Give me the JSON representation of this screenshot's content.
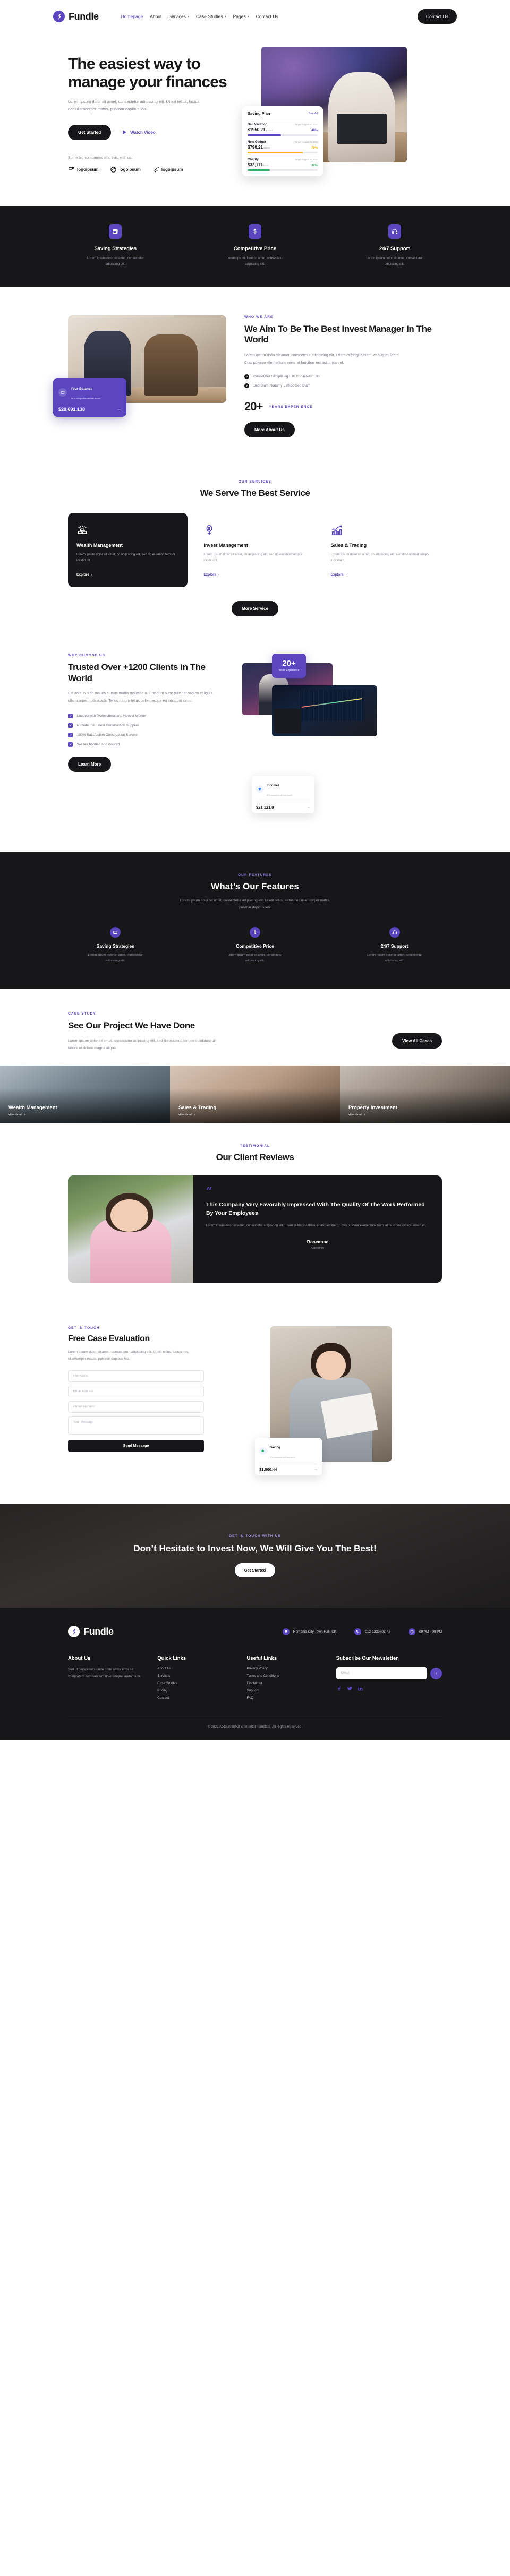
{
  "brand": {
    "name": "Fundle",
    "mark": "fundle-logo-icon"
  },
  "nav": {
    "links": [
      {
        "label": "Homepage",
        "active": true,
        "caret": false
      },
      {
        "label": "About",
        "active": false,
        "caret": false
      },
      {
        "label": "Services",
        "active": false,
        "caret": true
      },
      {
        "label": "Case Studies",
        "active": false,
        "caret": true
      },
      {
        "label": "Pages",
        "active": false,
        "caret": true
      },
      {
        "label": "Contact Us",
        "active": false,
        "caret": false
      }
    ],
    "cta": "Contact Us"
  },
  "hero": {
    "title": "The easiest way to manage your finances",
    "subtitle": "Lorem ipsum dolor sit amet, consectetur adipiscing elit. Ut elit tellus, luctus nec ullamcorper mattis, pulvinar dapibus leo.",
    "primary_cta": "Get Started",
    "video_cta": "Watch Video",
    "trust_label": "Some big companies who trust with us:",
    "logos": [
      "logoipsum",
      "logoipsum",
      "logoipsum"
    ],
    "saving_card": {
      "title": "Saving Plan",
      "see_all": "See All",
      "rows": [
        {
          "name": "Bali Vacation",
          "target": "Target: August 25 2022",
          "amount": "$1950,21",
          "of": "/$4000",
          "pct": "48%",
          "pct_color": "#5b46c0",
          "fill": 48
        },
        {
          "name": "New Gadget",
          "target": "Target: August 25 2022",
          "amount": "$790,21",
          "of": "/$1000",
          "pct": "79%",
          "pct_color": "#f2b705",
          "fill": 79
        },
        {
          "name": "Charity",
          "target": "Target: August 25 2022",
          "amount": "$32,111",
          "of": "/$100",
          "pct": "32%",
          "pct_color": "#34b36a",
          "fill": 32
        }
      ]
    }
  },
  "strip": {
    "items": [
      {
        "icon": "wallet-icon",
        "title": "Saving Strategies",
        "text": "Lorem ipsum dolor sit amet, consectetur adipiscing elit."
      },
      {
        "icon": "dollar-icon",
        "title": "Competitive Price",
        "text": "Lorem ipsum dolor sit amet, consectetur adipiscing elit."
      },
      {
        "icon": "headset-icon",
        "title": "24/7 Support",
        "text": "Lorem ipsum dolor sit amet, consectetur adipiscing elit."
      }
    ]
  },
  "about": {
    "eyebrow": "WHO WE ARE",
    "title": "We Aim To Be The Best Invest Manager In The World",
    "body": "Lorem ipsum dolor sit amet, consectetur adipiscing elit. Etiam et fringilla diam, et aliquet libero. Cras pulvinar elementum enim, at faucibus est accumsan et.",
    "ticks": [
      "Consetetur Sadipscing Elitr Consetetur Elitr",
      "Sed Diam Nonumy Eirmod Sed Diam"
    ],
    "years_number": "20+",
    "years_label": "YEARS EXPERIENCE",
    "cta": "More About Us",
    "balance_card": {
      "title": "Your Balance",
      "sub": "13 % compared with last month",
      "amount": "$28,891,138",
      "arrow": "→"
    }
  },
  "services": {
    "eyebrow": "OUR SERVICES",
    "title": "We Serve The Best Service",
    "cards": [
      {
        "icon": "gold-bars-icon",
        "title": "Wealth Management",
        "text": "Lorem ipsum dolor sit amet, co adipiscing elit, sed do eiusmod tempor incididunt.",
        "link": "Explore",
        "dark": true
      },
      {
        "icon": "money-plant-icon",
        "title": "Invest Management",
        "text": "Lorem ipsum dolor sit amet, co adipiscing elit, sed do eiusmod tempor incididunt.",
        "link": "Explore",
        "dark": false
      },
      {
        "icon": "chart-up-icon",
        "title": "Sales & Trading",
        "text": "Lorem ipsum dolor sit amet, co adipiscing elit, sed do eiusmod tempor incididunt.",
        "link": "Explore",
        "dark": false
      }
    ],
    "more_cta": "More Service"
  },
  "why": {
    "eyebrow": "WHY CHOOSE US",
    "title": "Trusted Over +1200 Clients in The World",
    "body": "Est ante in nibh mauris cursus mattis molestie a. Tincidunt nunc pulvinar sapien et ligula ullamcorper malesuada. Tellus rutrum tellus pellentesque eu tincidunt tortor.",
    "checks": [
      "Loaded with Professional and Honest Worker",
      "Provide the Finest Construction Supplies",
      "100% Satisfaction Construction Service",
      "We are bonded and insured"
    ],
    "cta": "Learn More",
    "badge": {
      "number": "20+",
      "label": "Years Experience"
    },
    "income_card": {
      "title": "Incomes",
      "sub": "6 % compared with last month",
      "amount": "$21,121.0",
      "arrow": "→"
    }
  },
  "features": {
    "eyebrow": "OUR FEATURES",
    "title": "What’s Our Features",
    "lead": "Lorem ipsum dolor sit amet, consectetur adipiscing elit. Ut elit tellus, luctus nec ullamcorper mattis, pulvinar dapibus leo.",
    "items": [
      {
        "icon": "wallet-icon",
        "title": "Saving Strategies",
        "text": "Lorem ipsum dolor sit amet, consectetur adipiscing elit."
      },
      {
        "icon": "dollar-icon",
        "title": "Competitive Price",
        "text": "Lorem ipsum dolor sit amet, consectetur adipiscing elit."
      },
      {
        "icon": "headset-icon",
        "title": "24/7 Support",
        "text": "Lorem ipsum dolor sit amet, consectetur adipiscing elit."
      }
    ]
  },
  "case": {
    "eyebrow": "CASE STUDY",
    "title": "See Our Project We Have Done",
    "body": "Lorem ipsum dolor sit amet, consectetur adipiscing elit, sed do eiusmod tempor incididunt ut labore et dolore magna aliqua.",
    "cta": "View All Cases",
    "projects": [
      {
        "title": "Wealth Management",
        "link": "view detail"
      },
      {
        "title": "Sales & Trading",
        "link": "view detail"
      },
      {
        "title": "Property Investment",
        "link": "view detail"
      }
    ]
  },
  "testimonial": {
    "eyebrow": "TESTIMONIAL",
    "title": "Our Client Reviews",
    "quote_mark": "“",
    "headline": "This Company Very Favorably Impressed With The Quality Of The Work Performed By Your Employees",
    "body": "Lorem ipsum dolor sit amet, consectetur adipiscing elit. Etiam et fringilla diam, et aliquet libero. Cras pulvinar elementum enim, at faucibus est accumsan et.",
    "name": "Roseanne",
    "role": "Customer"
  },
  "contact": {
    "eyebrow": "GET IN TOUCH",
    "title": "Free Case Evaluation",
    "body": "Lorem ipsum dolor sit amet, consectetur adipiscing elit. Ut elit tellus, luctus nec ullamcorper mattis, pulvinar dapibus leo.",
    "fields": [
      {
        "name": "full-name-field",
        "placeholder": "Full Name",
        "value": ""
      },
      {
        "name": "email-field",
        "placeholder": "Email Address",
        "value": ""
      },
      {
        "name": "phone-field",
        "placeholder": "Phone Number",
        "value": ""
      }
    ],
    "message_placeholder": "Your Message",
    "submit": "Send Message",
    "saving_mini": {
      "title": "Saving",
      "sub": "8 % compared with last month",
      "amount": "$1,000.44",
      "arrow": "→"
    }
  },
  "cta_band": {
    "eyebrow": "GET IN TOUCH WITH US",
    "title": "Don’t Hesitate to Invest Now, We Will Give You The Best!",
    "button": "Get Started"
  },
  "footer": {
    "contacts": [
      {
        "icon": "location-pin-icon",
        "text": "Romania City Town Hall, UK"
      },
      {
        "icon": "phone-icon",
        "text": "012-1239803-42"
      },
      {
        "icon": "clock-icon",
        "text": "09 AM - 09 PM"
      }
    ],
    "about": {
      "heading": "About Us",
      "text": "Sed ut perspiciatis unde omni natus error sit voluptatem accusantium doloremque laudantium."
    },
    "quick": {
      "heading": "Quick Links",
      "items": [
        "About Us",
        "Services",
        "Case Studies",
        "Pricing",
        "Contact"
      ]
    },
    "useful": {
      "heading": "Useful Links",
      "items": [
        "Privacy Policy",
        "Terms and Conditions",
        "Disclaimer",
        "Support",
        "FAQ"
      ]
    },
    "newsletter": {
      "heading": "Subscribe Our Newsletter",
      "placeholder": "Email",
      "value": "",
      "button": "›"
    },
    "socials": [
      "facebook-icon",
      "twitter-icon",
      "linkedin-icon"
    ],
    "copyright": "© 2022 AccountingKit Elementor Template. All Rights Reserved."
  },
  "colors": {
    "accent": "#5b46c0",
    "dark": "#17171a",
    "muted": "#84848f"
  }
}
